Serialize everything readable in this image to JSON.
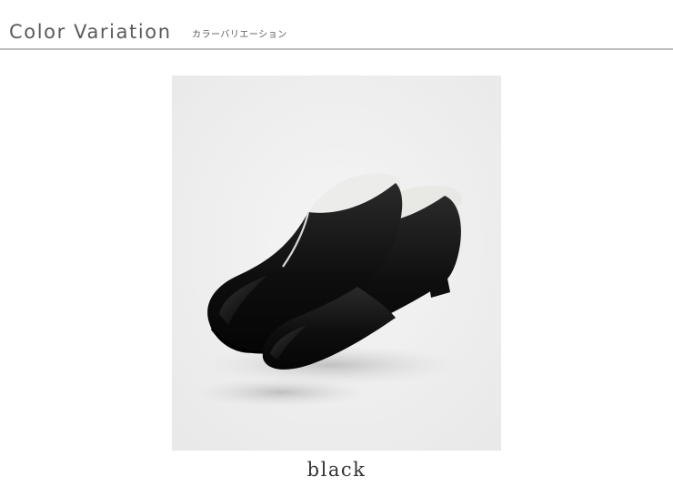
{
  "header": {
    "title": "Color Variation",
    "subtitle": "カラーバリエーション"
  },
  "product": {
    "image_subject": "black-slip-on-shoes-icon",
    "variant_label": "black"
  }
}
